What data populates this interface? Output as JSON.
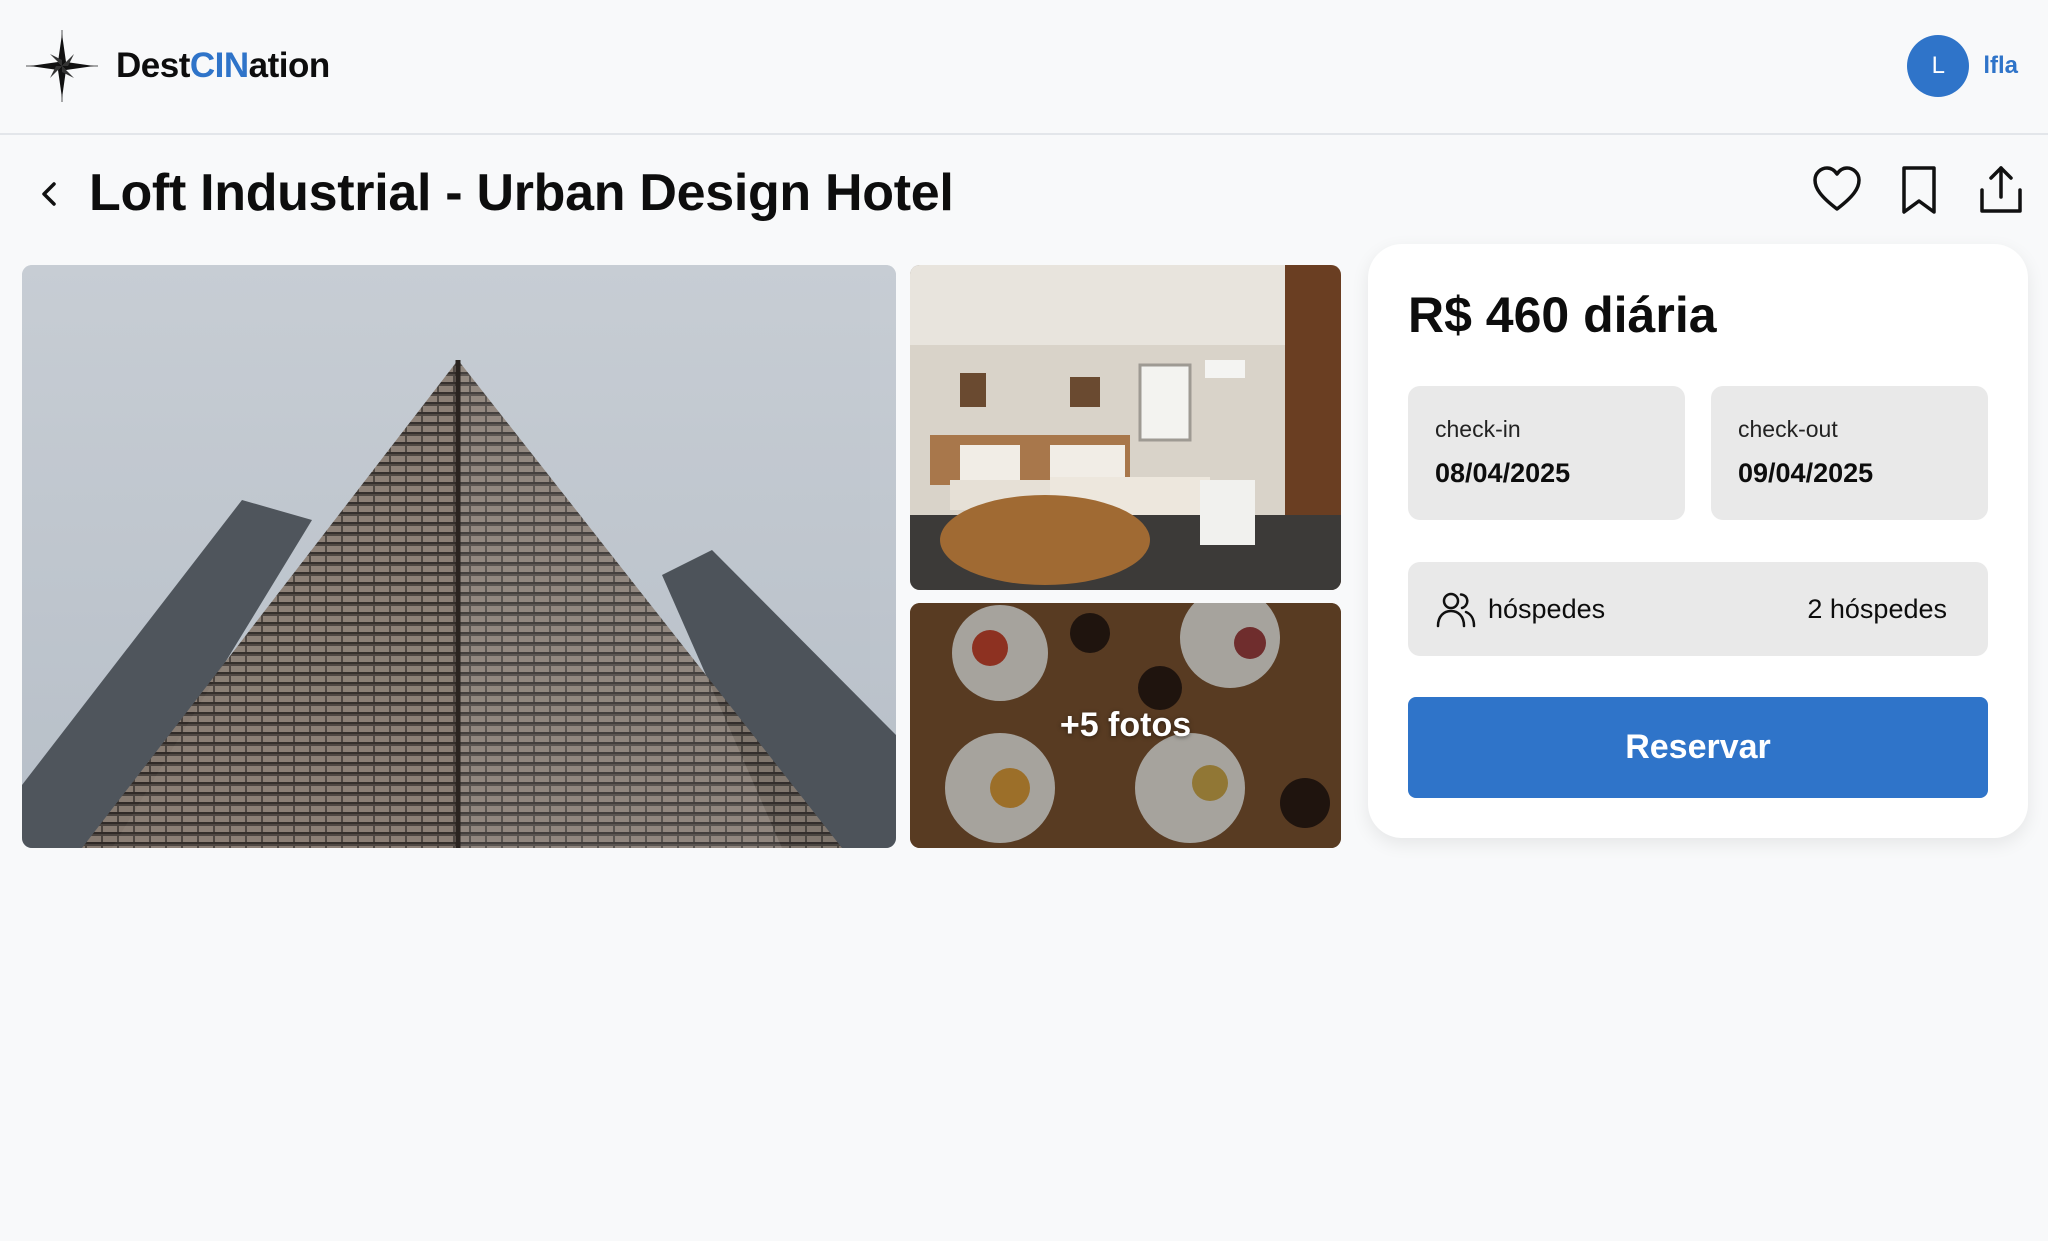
{
  "header": {
    "brand_prefix": "Dest",
    "brand_accent": "CIN",
    "brand_suffix": "ation",
    "avatar_letter": "L",
    "username": "lfla"
  },
  "page": {
    "title": "Loft Industrial - Urban Design Hotel"
  },
  "gallery": {
    "more_photos_label": "+5 fotos"
  },
  "booking": {
    "price": "R$ 460 diária",
    "checkin_label": "check-in",
    "checkin_value": "08/04/2025",
    "checkout_label": "check-out",
    "checkout_value": "09/04/2025",
    "guests_label": "hóspedes",
    "guests_value": "2 hóspedes",
    "reserve_label": "Reservar"
  },
  "icons": {
    "logo": "compass-star-icon",
    "back": "chevron-left-icon",
    "favorite": "heart-icon",
    "save": "bookmark-icon",
    "share": "share-icon",
    "guests": "users-icon"
  },
  "colors": {
    "accent": "#2f74c9",
    "background": "#f8f9fa",
    "field": "#e9e9e9"
  }
}
